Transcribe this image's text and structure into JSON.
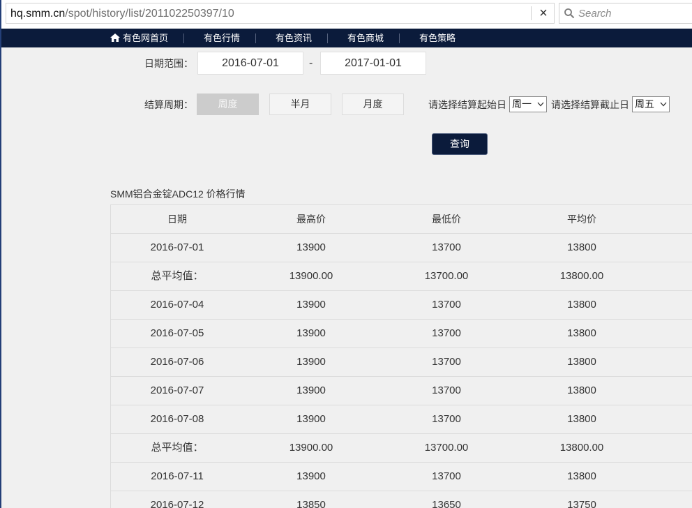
{
  "browser": {
    "url_host": "hq.smm.cn",
    "url_path": "/spot/history/list/201102250397/10",
    "close_label": "×",
    "search_placeholder": "Search"
  },
  "nav": {
    "home_icon": "home-icon",
    "items": [
      "有色网首页",
      "有色行情",
      "有色资讯",
      "有色商城",
      "有色策略"
    ]
  },
  "filters": {
    "date_range_label": "日期范围：",
    "start_date": "2016-07-01",
    "date_separator": "-",
    "end_date": "2017-01-01",
    "period_label": "结算周期：",
    "period_options": [
      {
        "label": "周度",
        "selected": true
      },
      {
        "label": "半月",
        "selected": false
      },
      {
        "label": "月度",
        "selected": false
      }
    ],
    "start_day_label": "请选择结算起始日",
    "start_day_value": "周一",
    "end_day_label": "请选择结算截止日",
    "end_day_value": "周五",
    "query_label": "查询"
  },
  "table": {
    "title": "SMM铝合金锭ADC12 价格行情",
    "headers": [
      "日期",
      "最高价",
      "最低价",
      "平均价"
    ],
    "rows": [
      [
        "2016-07-01",
        "13900",
        "13700",
        "13800"
      ],
      [
        "总平均值：",
        "13900.00",
        "13700.00",
        "13800.00"
      ],
      [
        "2016-07-04",
        "13900",
        "13700",
        "13800"
      ],
      [
        "2016-07-05",
        "13900",
        "13700",
        "13800"
      ],
      [
        "2016-07-06",
        "13900",
        "13700",
        "13800"
      ],
      [
        "2016-07-07",
        "13900",
        "13700",
        "13800"
      ],
      [
        "2016-07-08",
        "13900",
        "13700",
        "13800"
      ],
      [
        "总平均值：",
        "13900.00",
        "13700.00",
        "13800.00"
      ],
      [
        "2016-07-11",
        "13900",
        "13700",
        "13800"
      ],
      [
        "2016-07-12",
        "13850",
        "13650",
        "13750"
      ]
    ]
  },
  "colors": {
    "nav_bg": "#0b1b3b",
    "page_bg": "#f0f0f0",
    "selected_option_bg": "#cccccc",
    "query_button_bg": "#0b1b3b"
  }
}
